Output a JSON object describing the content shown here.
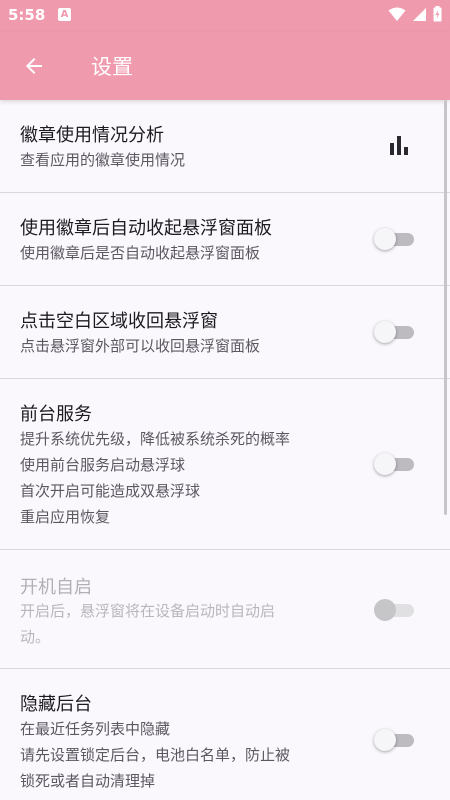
{
  "status_bar": {
    "time": "5:58",
    "notification_badge": "A",
    "icons": [
      "wifi-icon",
      "cell-signal-icon",
      "battery-icon"
    ],
    "background": "#f09aae"
  },
  "app_bar": {
    "title": "设置",
    "back_icon": "arrow-left-icon",
    "background": "#f09aae"
  },
  "settings": [
    {
      "title": "徽章使用情况分析",
      "subtitle": [
        "查看应用的徽章使用情况"
      ],
      "control": "bar-chart-icon"
    },
    {
      "title": "使用徽章后自动收起悬浮窗面板",
      "subtitle": [
        "使用徽章后是否自动收起悬浮窗面板"
      ],
      "control": "switch",
      "checked": false
    },
    {
      "title": "点击空白区域收回悬浮窗",
      "subtitle": [
        "点击悬浮窗外部可以收回悬浮窗面板"
      ],
      "control": "switch",
      "checked": false
    },
    {
      "title": "前台服务",
      "subtitle": [
        "提升系统优先级，降低被系统杀死的概率",
        "使用前台服务启动悬浮球",
        "首次开启可能造成双悬浮球",
        "重启应用恢复"
      ],
      "control": "switch",
      "checked": false
    },
    {
      "title": "开机自启",
      "subtitle": [
        "开启后，悬浮窗将在设备启动时自动启",
        "动。"
      ],
      "control": "switch",
      "checked": false,
      "enabled": false
    },
    {
      "title": "隐藏后台",
      "subtitle": [
        "在最近任务列表中隐藏",
        "请先设置锁定后台，电池白名单，防止被",
        "锁死或者自动清理掉"
      ],
      "control": "switch",
      "checked": false
    }
  ]
}
